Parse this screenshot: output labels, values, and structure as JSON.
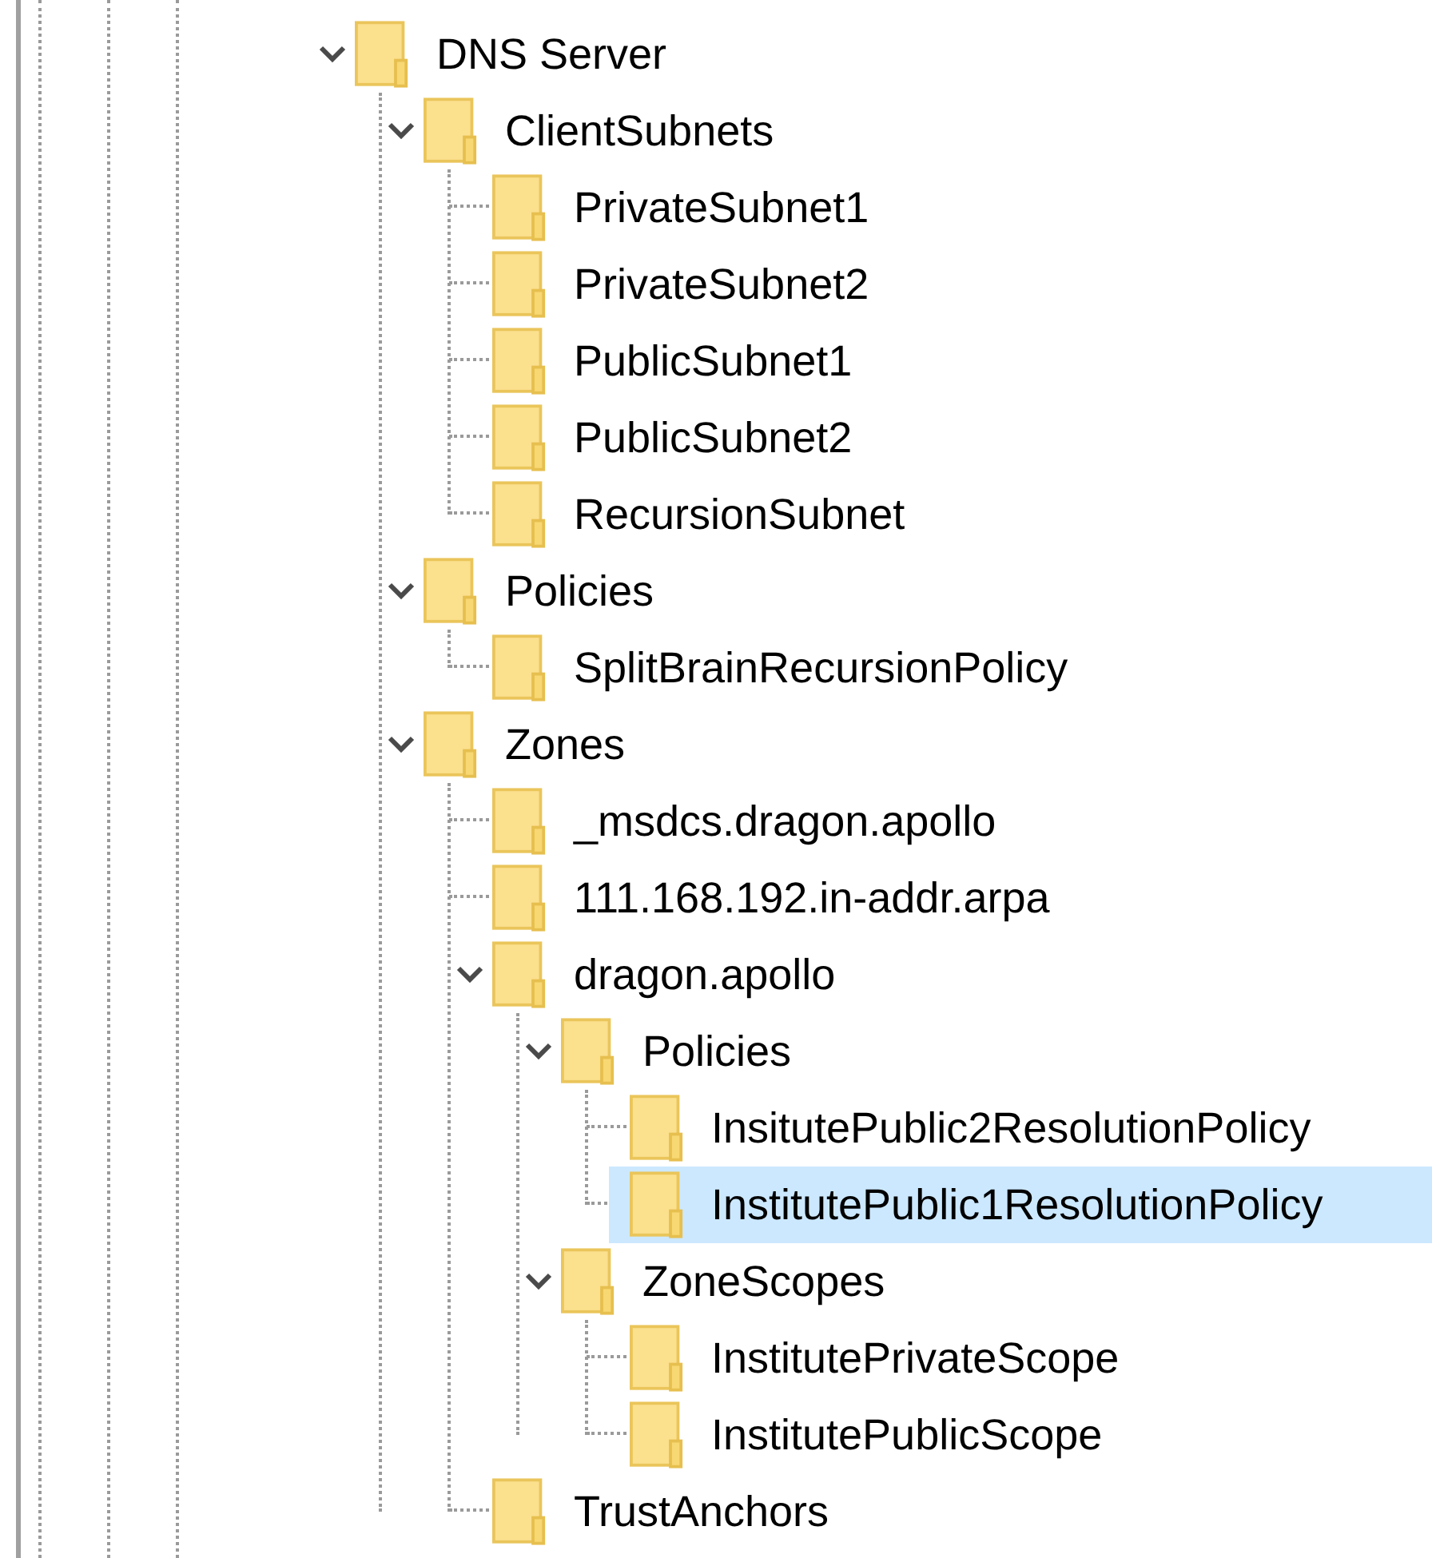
{
  "tree": {
    "nodes": [
      {
        "label": "DNS Server",
        "expanded": true,
        "selected": false,
        "children": [
          {
            "label": "ClientSubnets",
            "expanded": true,
            "selected": false,
            "children": [
              {
                "label": "PrivateSubnet1",
                "selected": false
              },
              {
                "label": "PrivateSubnet2",
                "selected": false
              },
              {
                "label": "PublicSubnet1",
                "selected": false
              },
              {
                "label": "PublicSubnet2",
                "selected": false
              },
              {
                "label": "RecursionSubnet",
                "selected": false
              }
            ]
          },
          {
            "label": "Policies",
            "expanded": true,
            "selected": false,
            "children": [
              {
                "label": "SplitBrainRecursionPolicy",
                "selected": false
              }
            ]
          },
          {
            "label": "Zones",
            "expanded": true,
            "selected": false,
            "children": [
              {
                "label": "_msdcs.dragon.apollo",
                "selected": false
              },
              {
                "label": "111.168.192.in-addr.arpa",
                "selected": false
              },
              {
                "label": "dragon.apollo",
                "expanded": true,
                "selected": false,
                "children": [
                  {
                    "label": "Policies",
                    "expanded": true,
                    "selected": false,
                    "children": [
                      {
                        "label": "InsitutePublic2ResolutionPolicy",
                        "selected": false
                      },
                      {
                        "label": "InstitutePublic1ResolutionPolicy",
                        "selected": true
                      }
                    ]
                  },
                  {
                    "label": "ZoneScopes",
                    "expanded": true,
                    "selected": false,
                    "children": [
                      {
                        "label": "InstitutePrivateScope",
                        "selected": false
                      },
                      {
                        "label": "InstitutePublicScope",
                        "selected": false
                      }
                    ]
                  }
                ]
              },
              {
                "label": "TrustAnchors",
                "selected": false
              }
            ]
          }
        ]
      }
    ]
  }
}
